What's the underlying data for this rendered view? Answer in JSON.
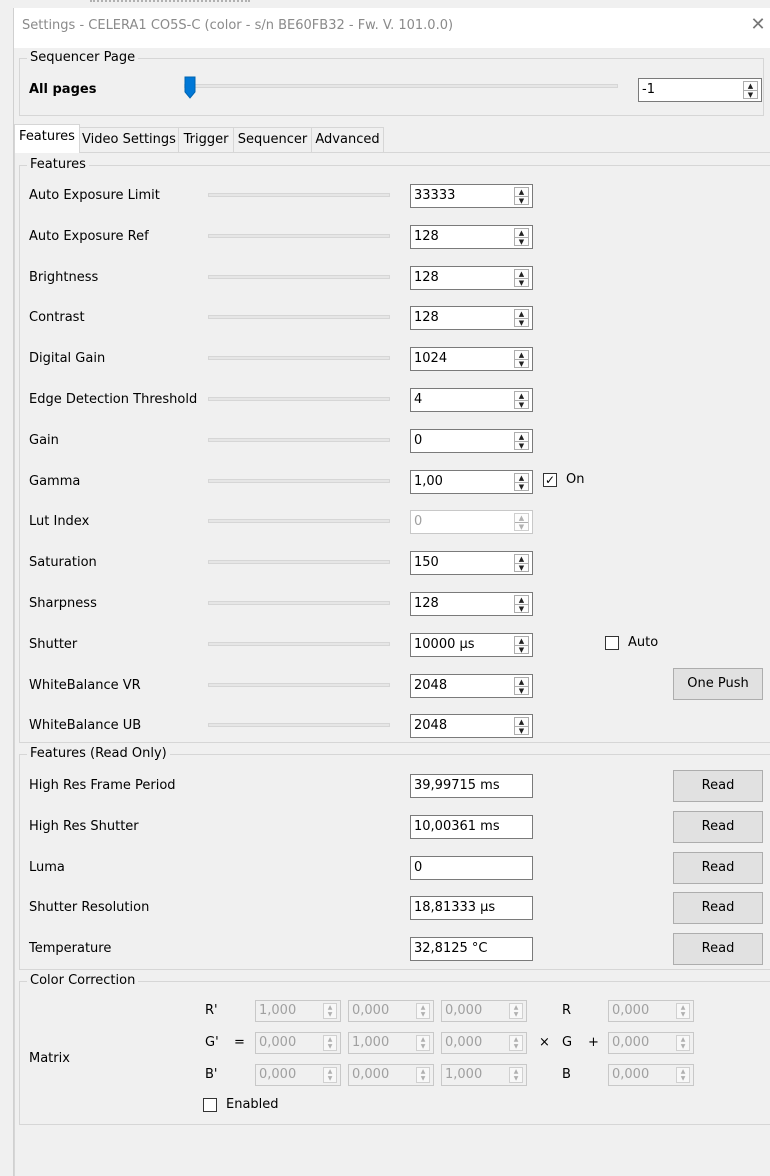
{
  "window": {
    "title": "Settings - CELERA1 CO5S-C (color - s/n BE60FB32 - Fw. V. 101.0.0)",
    "close": "✕"
  },
  "sequencer_page": {
    "group_label": "Sequencer Page",
    "label": "All pages",
    "value": "-1",
    "slider_fraction": 0.0
  },
  "tabs": [
    "Features",
    "Video Settings",
    "Trigger",
    "Sequencer",
    "Advanced"
  ],
  "active_tab": "Features",
  "features": {
    "group_label": "Features",
    "rows": [
      {
        "label": "Auto Exposure Limit",
        "value": "33333",
        "slider_fraction": 0.56,
        "enabled": true
      },
      {
        "label": "Auto Exposure Ref",
        "value": "128",
        "slider_fraction": 0.49,
        "enabled": true
      },
      {
        "label": "Brightness",
        "value": "128",
        "slider_fraction": 0.49,
        "enabled": true
      },
      {
        "label": "Contrast",
        "value": "128",
        "slider_fraction": 0.49,
        "enabled": true
      },
      {
        "label": "Digital Gain",
        "value": "1024",
        "slider_fraction": 0.49,
        "enabled": true
      },
      {
        "label": "Edge Detection Threshold",
        "value": "4",
        "slider_fraction": 0.02,
        "enabled": true
      },
      {
        "label": "Gain",
        "value": "0",
        "slider_fraction": 0.0,
        "enabled": true
      },
      {
        "label": "Gamma",
        "value": "1,00",
        "slider_fraction": 0.49,
        "enabled": true
      },
      {
        "label": "Lut Index",
        "value": "0",
        "slider_fraction": 0.0,
        "enabled": false
      },
      {
        "label": "Saturation",
        "value": "150",
        "slider_fraction": 0.57,
        "enabled": true
      },
      {
        "label": "Sharpness",
        "value": "128",
        "slider_fraction": 0.49,
        "enabled": true
      },
      {
        "label": "Shutter",
        "value": "10000 µs",
        "slider_fraction": 0.52,
        "enabled": true
      },
      {
        "label": "WhiteBalance VR",
        "value": "2048",
        "slider_fraction": 0.42,
        "enabled": true
      },
      {
        "label": "WhiteBalance UB",
        "value": "2048",
        "slider_fraction": 0.42,
        "enabled": true
      }
    ],
    "gamma_on": {
      "label": "On",
      "checked": true
    },
    "shutter_auto": {
      "label": "Auto",
      "checked": false
    },
    "one_push_label": "One Push"
  },
  "readonly": {
    "group_label": "Features (Read Only)",
    "read_label": "Read",
    "rows": [
      {
        "label": "High Res Frame Period",
        "value": "39,99715 ms"
      },
      {
        "label": "High Res Shutter",
        "value": "10,00361 ms"
      },
      {
        "label": "Luma",
        "value": "0"
      },
      {
        "label": "Shutter Resolution",
        "value": "18,81333 µs"
      },
      {
        "label": "Temperature",
        "value": "32,8125 °C"
      }
    ]
  },
  "color_correction": {
    "group_label": "Color Correction",
    "matrix_label": "Matrix",
    "row_labels": [
      "R'",
      "G'",
      "B'"
    ],
    "equals": "=",
    "times": "×",
    "plus": "+",
    "col_labels": [
      "R",
      "G",
      "B"
    ],
    "matrix": [
      [
        "1,000",
        "0,000",
        "0,000"
      ],
      [
        "0,000",
        "1,000",
        "0,000"
      ],
      [
        "0,000",
        "0,000",
        "1,000"
      ]
    ],
    "offsets": [
      "0,000",
      "0,000",
      "0,000"
    ],
    "enabled": {
      "label": "Enabled",
      "checked": false
    }
  }
}
